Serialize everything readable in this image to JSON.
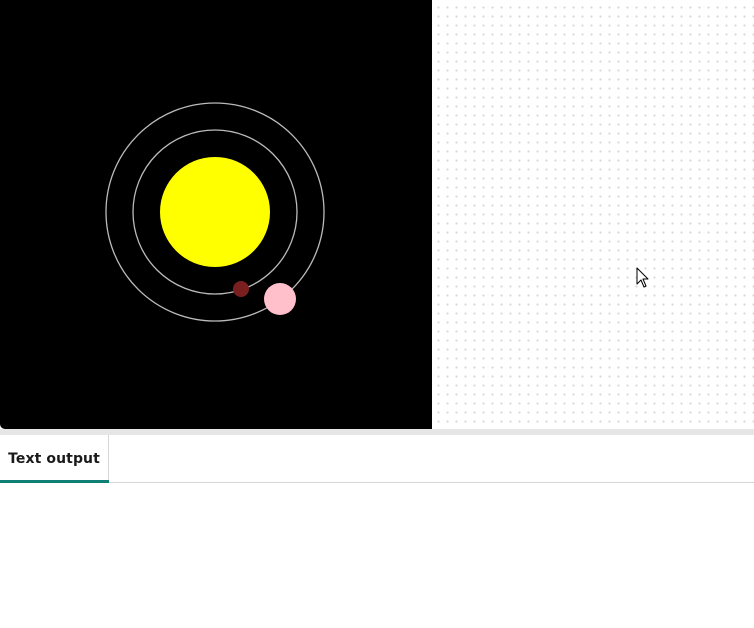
{
  "stage": {
    "canvas_background": "#000000",
    "sun_color": "#ffff00",
    "orbit_color": "#bbbbbb",
    "inner_planet_color": "#7a1f1f",
    "outer_planet_color": "#ffc0cb",
    "cursor_icon": "arrow-pointer-icon"
  },
  "output": {
    "tabs": [
      {
        "label": "Text output",
        "active": true
      }
    ],
    "accent_color": "#0f7f75",
    "text": ""
  }
}
